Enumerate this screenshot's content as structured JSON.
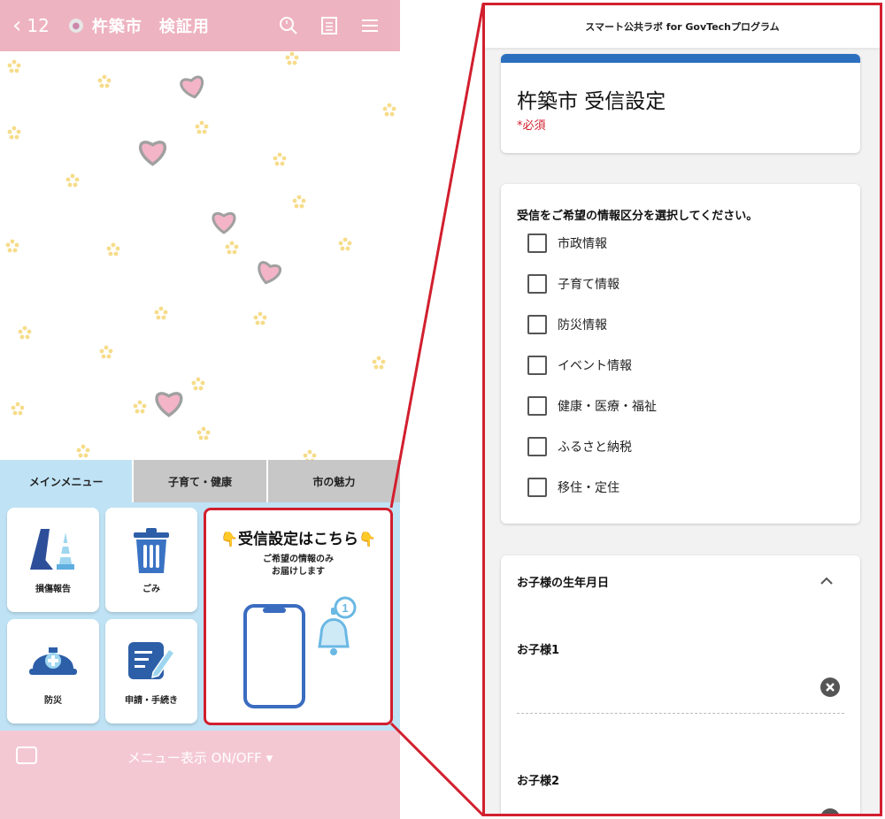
{
  "phone": {
    "header": {
      "back_count": "12",
      "title": "杵築市　検証用"
    },
    "tabs": [
      {
        "label": "メインメニュー",
        "active": true
      },
      {
        "label": "子育て・健康",
        "active": false
      },
      {
        "label": "市の魅力",
        "active": false
      }
    ],
    "menu_tiles": [
      {
        "label": "損傷報告",
        "icon": "road-cone-icon"
      },
      {
        "label": "ごみ",
        "icon": "trash-can-icon"
      },
      {
        "label": "防災",
        "icon": "helmet-icon"
      },
      {
        "label": "申請・手続き",
        "icon": "form-pen-icon"
      }
    ],
    "promo": {
      "headline": "受信設定はこちら",
      "line1": "ご希望の情報のみ",
      "line2": "お届けします",
      "badge_count": "1"
    },
    "footer_label": "メニュー表示 ON/OFF ▾"
  },
  "form": {
    "app_title": "スマート公共ラボ for GovTechプログラム",
    "title": "杵築市 受信設定",
    "required_note": "*必須",
    "question": "受信をご希望の情報区分を選択してください。",
    "options": [
      "市政情報",
      "子育て情報",
      "防災情報",
      "イベント情報",
      "健康・医療・福祉",
      "ふるさと納税",
      "移住・定住"
    ],
    "child_section": {
      "heading": "お子様の生年月日",
      "child1_label": "お子様1",
      "child2_label": "お子様2"
    }
  },
  "colors": {
    "header_pink": "#eeb3c0",
    "menu_blue": "#bfe3f5",
    "highlight_red": "#d21f2e",
    "form_accent_blue": "#2d6fbf"
  }
}
